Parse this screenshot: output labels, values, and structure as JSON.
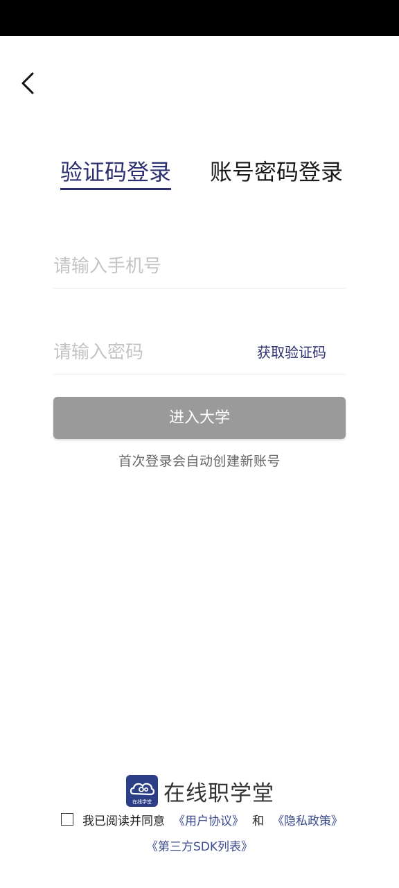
{
  "tabs": {
    "sms_login": "验证码登录",
    "password_login": "账号密码登录"
  },
  "form": {
    "phone_placeholder": "请输入手机号",
    "code_placeholder": "请输入密码",
    "get_code_label": "获取验证码",
    "submit_label": "进入大学",
    "hint": "首次登录会自动创建新账号"
  },
  "brand": {
    "logo_text": "在线学堂",
    "name": "在线职学堂"
  },
  "agreement": {
    "prefix": "我已阅读并同意",
    "user_agreement": "《用户协议》",
    "and": "和",
    "privacy_policy": "《隐私政策》",
    "sdk_list": "《第三方SDK列表》"
  },
  "colors": {
    "accent": "#2c2f70",
    "button_disabled": "#9a9a9a",
    "link": "#3b4a8c",
    "status_bar": "#000000"
  },
  "icons": {
    "back": "chevron-left-icon",
    "logo": "cloud-logo-icon",
    "checkbox": "checkbox-unchecked-icon"
  }
}
